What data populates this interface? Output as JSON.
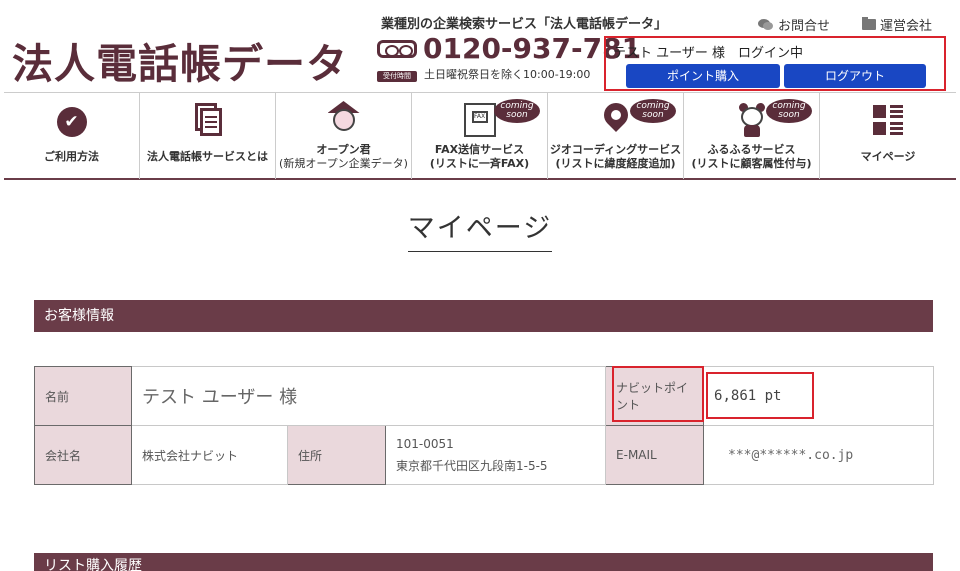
{
  "header": {
    "logo": "法人電話帳データ",
    "tagline": "業種別の企業検索サービス「法人電話帳データ」",
    "phone_number": "0120-937-781",
    "phone_badge": "受付時間",
    "phone_hours": "土日曜祝祭日を除く10:00-19:00",
    "contact_link": "お問合せ",
    "company_link": "運営会社",
    "login_status": "テスト ユーザー 様　ログイン中",
    "buy_points_button": "ポイント購入",
    "logout_button": "ログアウト"
  },
  "nav": {
    "coming_soon": "coming soon",
    "items": [
      {
        "line1": "ご利用方法",
        "line2": ""
      },
      {
        "line1": "法人電話帳サービスとは",
        "line2": ""
      },
      {
        "line1": "オープン君",
        "line2": "(新規オープン企業データ)"
      },
      {
        "line1": "FAX送信サービス",
        "line2": "(リストに一斉FAX)"
      },
      {
        "line1": "ジオコーディングサービス",
        "line2": "(リストに緯度経度追加)"
      },
      {
        "line1": "ふるふるサービス",
        "line2": "(リストに顧客属性付与)"
      },
      {
        "line1": "マイページ",
        "line2": ""
      }
    ],
    "fax_icon_text": "FAX"
  },
  "page": {
    "title": "マイページ"
  },
  "customer": {
    "section_title": "お客様情報",
    "name_label": "名前",
    "name_value": "テスト ユーザー 様",
    "points_label": "ナビットポイント",
    "points_value": "6,861 pt",
    "company_label": "会社名",
    "company_value": "株式会社ナビット",
    "address_label": "住所",
    "postal_code": "101-0051",
    "address": "東京都千代田区九段南1-5-5",
    "email_label": "E-MAIL",
    "email_value": "***@******.co.jp"
  },
  "history": {
    "section_title": "リスト購入履歴"
  }
}
